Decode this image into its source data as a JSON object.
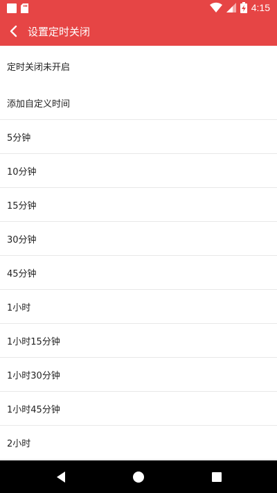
{
  "status_bar": {
    "time": "4:15"
  },
  "header": {
    "title": "设置定时关闭"
  },
  "items": [
    "定时关闭未开启",
    "添加自定义时间",
    "5分钟",
    "10分钟",
    "15分钟",
    "30分钟",
    "45分钟",
    "1小时",
    "1小时15分钟",
    "1小时30分钟",
    "1小时45分钟",
    "2小时"
  ],
  "colors": {
    "accent": "#e64545",
    "nav_bar": "#000000"
  },
  "icons": {
    "back": "chevron-left-icon",
    "nav_back": "triangle-back-icon",
    "nav_home": "circle-home-icon",
    "nav_recents": "square-recents-icon"
  }
}
